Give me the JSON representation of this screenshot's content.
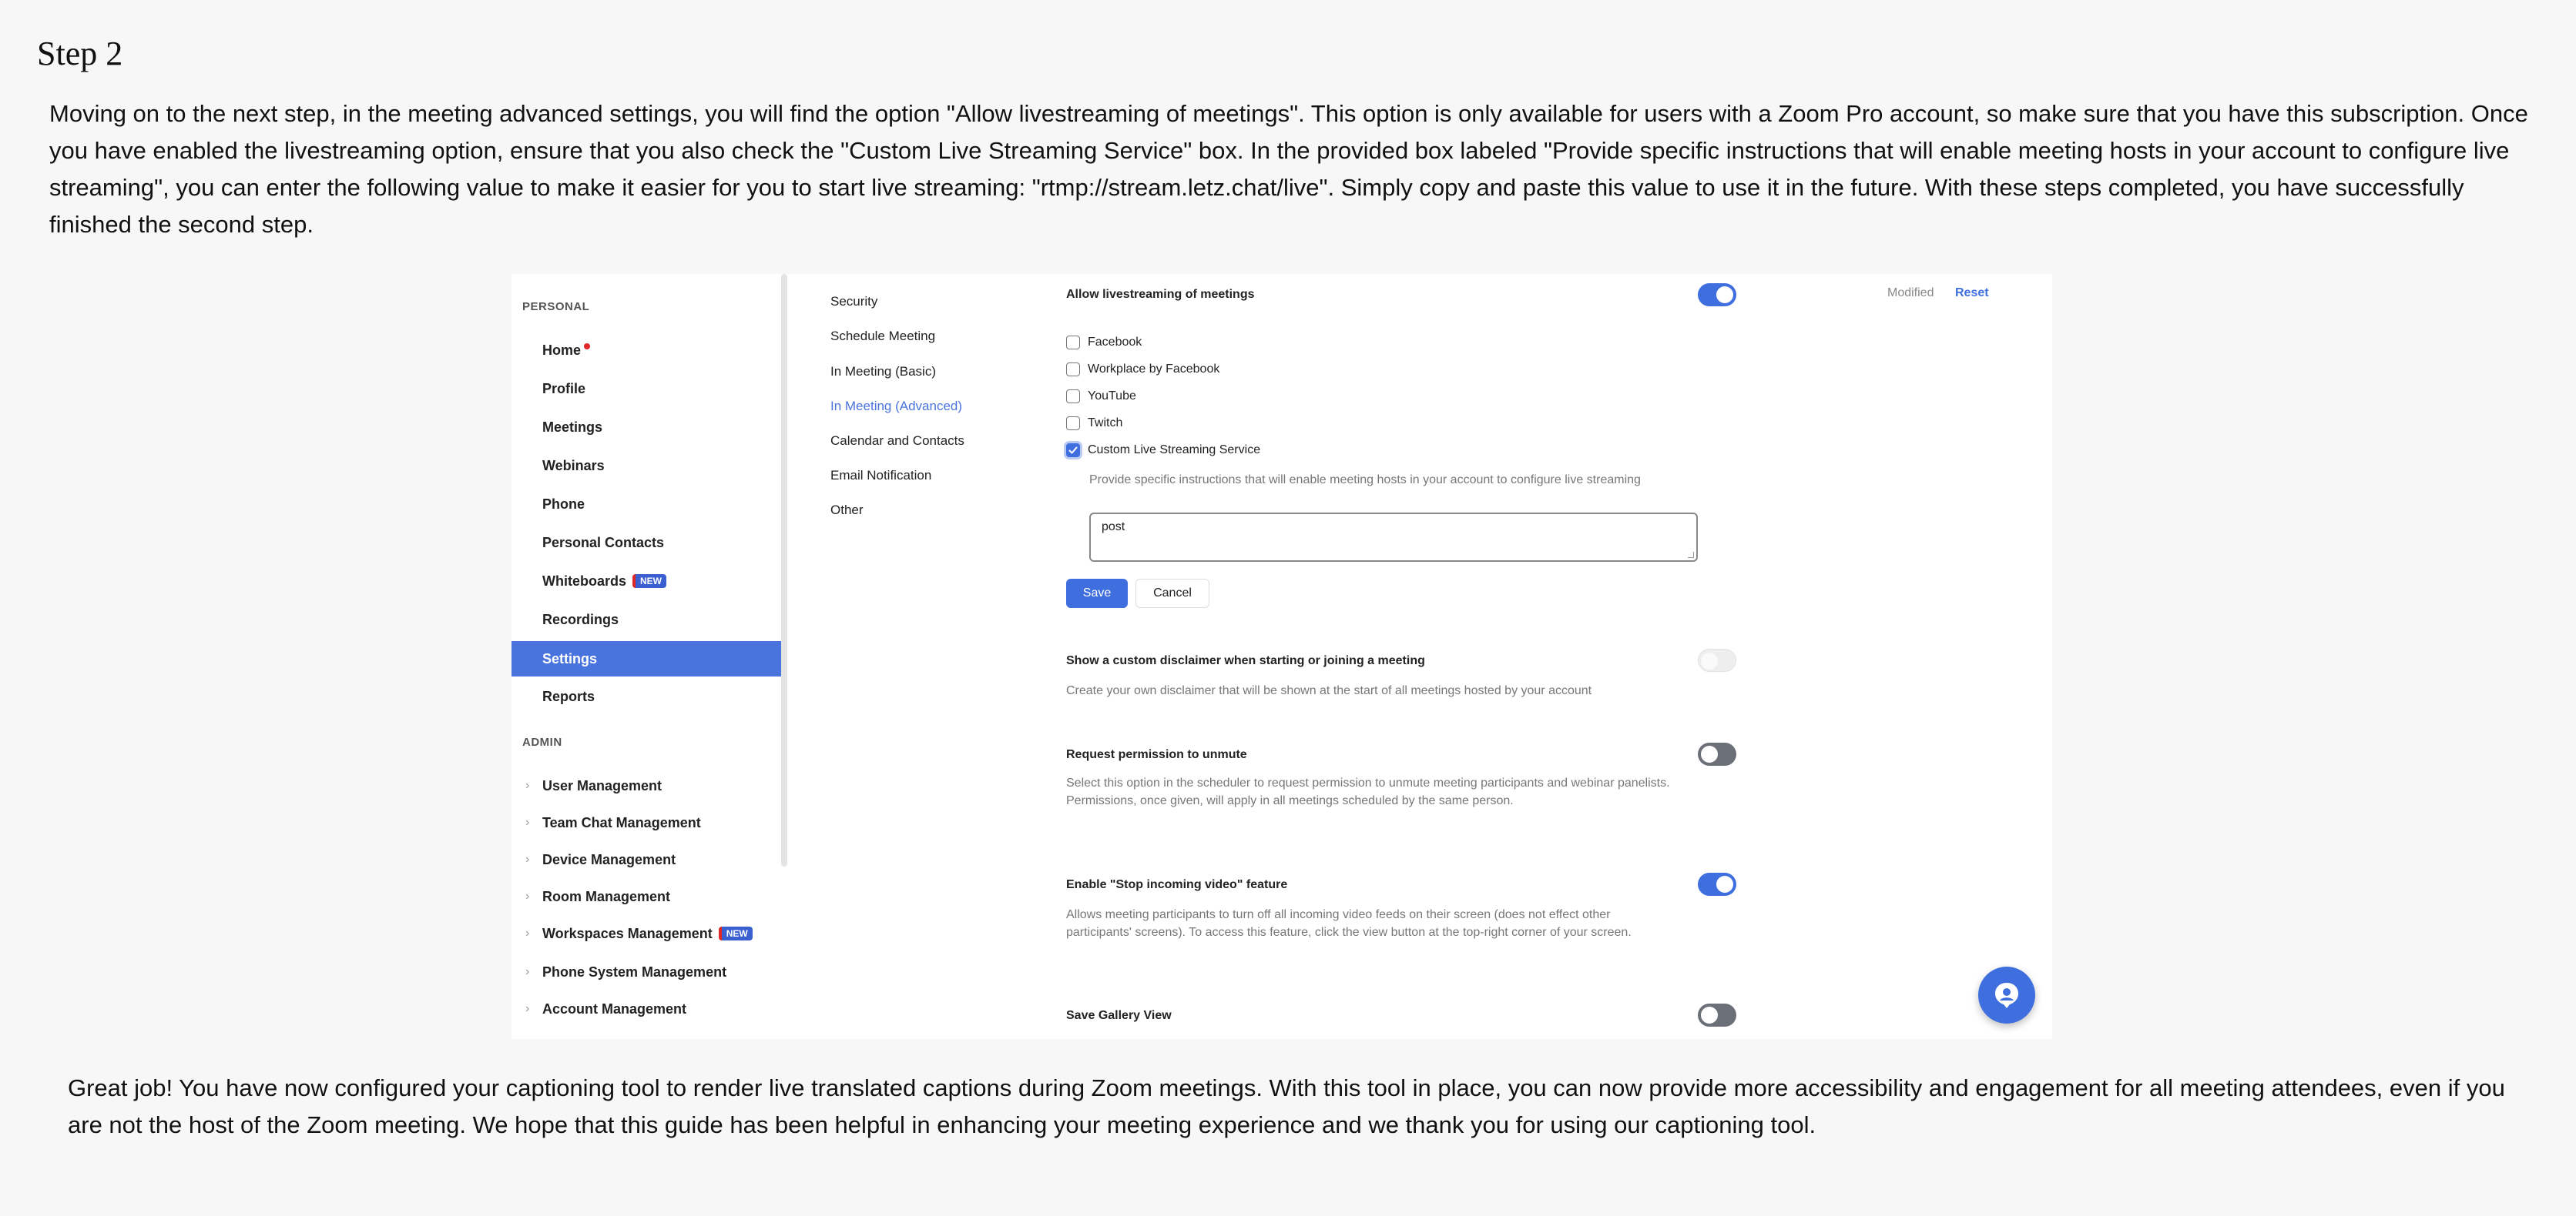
{
  "step_title": "Step 2",
  "intro_text": "Moving on to the next step, in the meeting advanced settings, you will find the option \"Allow livestreaming of meetings\". This option is only available for users with a Zoom Pro account, so make sure that you have this subscription. Once you have enabled the livestreaming option, ensure that you also check the \"Custom Live Streaming Service\" box. In the provided box labeled \"Provide specific instructions that will enable meeting hosts in your account to configure live streaming\", you can enter the following value to make it easier for you to start live streaming: \"rtmp://stream.letz.chat/live\". Simply copy and paste this value to use it in the future. With these steps completed, you have successfully finished the second step.",
  "outro_text": "Great job! You have now configured your captioning tool to render live translated captions during Zoom meetings. With this tool in place, you can now provide more accessibility and engagement for all meeting attendees, even if you are not the host of the Zoom meeting. We hope that this guide has been helpful in enhancing your meeting experience and we thank you for using our captioning tool.",
  "sidebar": {
    "personal_header": "PERSONAL",
    "admin_header": "ADMIN",
    "personal_items": [
      "Home",
      "Profile",
      "Meetings",
      "Webinars",
      "Phone",
      "Personal Contacts",
      "Whiteboards",
      "Recordings",
      "Settings",
      "Reports"
    ],
    "admin_items": [
      "User Management",
      "Team Chat Management",
      "Device Management",
      "Room Management",
      "Workspaces Management",
      "Phone System Management",
      "Account Management"
    ],
    "new_badge": "NEW",
    "active_item": "Settings"
  },
  "settings_nav": {
    "items": [
      "Security",
      "Schedule Meeting",
      "In Meeting (Basic)",
      "In Meeting (Advanced)",
      "Calendar and Contacts",
      "Email Notification",
      "Other"
    ],
    "active_item": "In Meeting (Advanced)"
  },
  "livestream": {
    "title": "Allow livestreaming of meetings",
    "enabled": true,
    "modified_label": "Modified",
    "reset_label": "Reset",
    "options": [
      {
        "label": "Facebook",
        "checked": false
      },
      {
        "label": "Workplace by Facebook",
        "checked": false
      },
      {
        "label": "YouTube",
        "checked": false
      },
      {
        "label": "Twitch",
        "checked": false
      },
      {
        "label": "Custom Live Streaming Service",
        "checked": true
      }
    ],
    "custom_instructions_label": "Provide specific instructions that will enable meeting hosts in your account to configure live streaming",
    "custom_instructions_value": "post",
    "save_label": "Save",
    "cancel_label": "Cancel"
  },
  "settings": [
    {
      "title": "Show a custom disclaimer when starting or joining a meeting",
      "desc": "Create your own disclaimer that will be shown at the start of all meetings hosted by your account",
      "state": "disabled"
    },
    {
      "title": "Request permission to unmute",
      "desc": "Select this option in the scheduler to request permission to unmute meeting participants and webinar panelists. Permissions, once given, will apply in all meetings scheduled by the same person.",
      "state": "off"
    },
    {
      "title": "Enable \"Stop incoming video\" feature",
      "desc": "Allows meeting participants to turn off all incoming video feeds on their screen (does not effect other participants' screens). To access this feature, click the view button at the top-right corner of your screen.",
      "state": "on"
    },
    {
      "title": "Save Gallery View",
      "desc": "",
      "state": "off"
    }
  ],
  "colors": {
    "accent": "#3f6fde",
    "sidebar_active": "#4a74dd",
    "new_badge": "#3a5fd0"
  },
  "icons": {
    "fab": "support-agent-icon",
    "chevron": "chevron-right-icon",
    "checkmark": "check-icon"
  }
}
